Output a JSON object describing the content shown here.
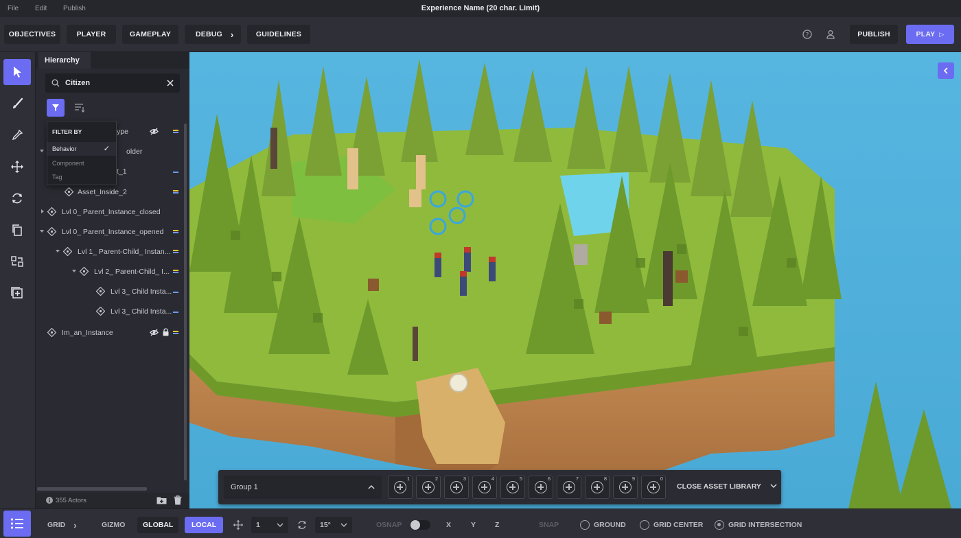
{
  "menu": {
    "file": "File",
    "edit": "Edit",
    "publish": "Publish",
    "title": "Experience Name (20 char. Limit)"
  },
  "toolbar": {
    "tabs": [
      "OBJECTIVES",
      "PLAYER",
      "GAMEPLAY",
      "DEBUG",
      "GUIDELINES"
    ],
    "publish": "PUBLISH",
    "play": "PLAY"
  },
  "hierarchy": {
    "tab": "Hierarchy",
    "search_value": "Citizen",
    "filter_menu": {
      "header": "FILTER BY",
      "items": [
        "Behavior",
        "Component",
        "Tag"
      ],
      "selected": "Behavior"
    },
    "rows": [
      {
        "label": "ype"
      },
      {
        "label": "older"
      },
      {
        "label": "t_1"
      },
      {
        "label": "Asset_Inside_2"
      },
      {
        "label": "Lvl 0_ Parent_Instance_closed"
      },
      {
        "label": "Lvl 0_ Parent_Instance_opened"
      },
      {
        "label": "Lvl 1_ Parent-Child_ Instan..."
      },
      {
        "label": "Lvl 2_ Parent-Child_ I..."
      },
      {
        "label": "Lvl 3_ Child Insta..."
      },
      {
        "label": "Lvl 3_ Child Insta..."
      },
      {
        "label": "Im_an_Instance"
      }
    ],
    "actors": "355 Actors"
  },
  "assetbar": {
    "group": "Group 1",
    "slots": [
      "1",
      "2",
      "3",
      "4",
      "5",
      "6",
      "7",
      "8",
      "9",
      "0"
    ],
    "close": "CLOSE ASSET LIBRARY"
  },
  "bottombar": {
    "grid": "GRID",
    "gizmo": "GIZMO",
    "global": "GLOBAL",
    "local": "LOCAL",
    "move_value": "1",
    "rotate_value": "15°",
    "osnap": "OSNAP",
    "x": "X",
    "y": "Y",
    "z": "Z",
    "snap": "SNAP",
    "ground": "GROUND",
    "grid_center": "GRID CENTER",
    "grid_intersection": "GRID INTERSECTION",
    "selected_snap": "GRID INTERSECTION"
  },
  "colors": {
    "accent": "#6b6cf2",
    "bg": "#2b2c33",
    "sky": "#4fb2dc",
    "grass": "#8fb83a",
    "dirt": "#c08a50",
    "tree": "#6d8f2c"
  }
}
